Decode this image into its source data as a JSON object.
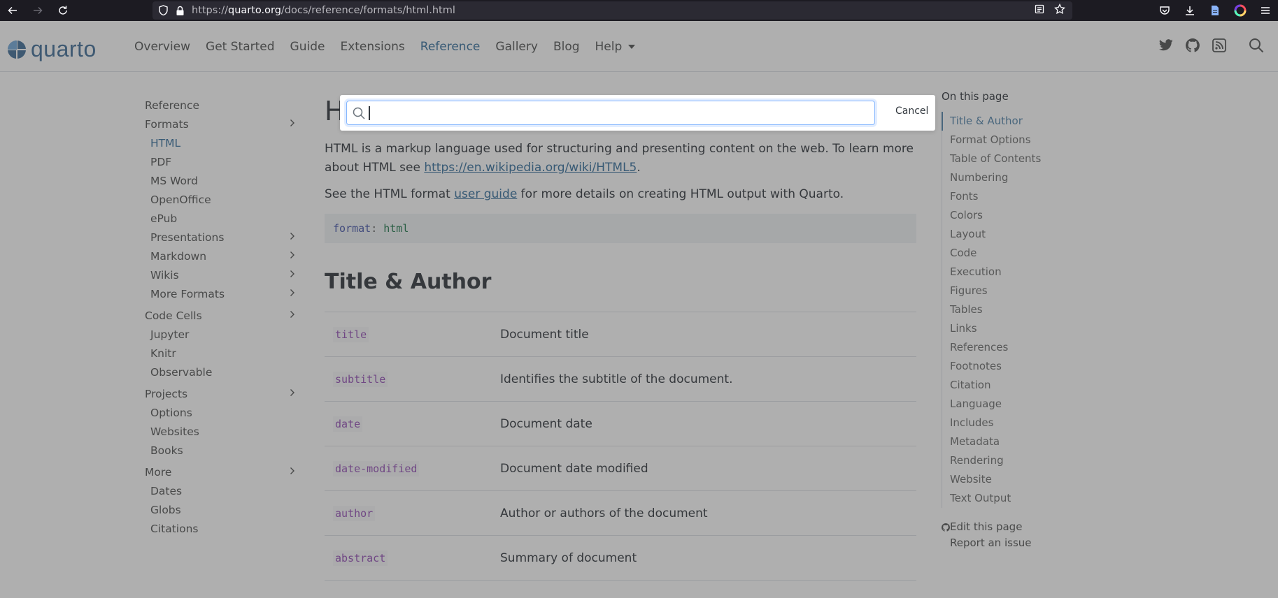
{
  "browser": {
    "url_scheme": "https://",
    "url_host": "quarto.org",
    "url_path": "/docs/reference/formats/html.html"
  },
  "header": {
    "logo_text": "quarto",
    "nav": [
      "Overview",
      "Get Started",
      "Guide",
      "Extensions",
      "Reference",
      "Gallery",
      "Blog",
      "Help"
    ],
    "active_nav": "Reference"
  },
  "sidebar": {
    "items": [
      {
        "label": "Reference",
        "level": 0,
        "chevron": false
      },
      {
        "label": "Formats",
        "level": 0,
        "chevron": true
      },
      {
        "label": "HTML",
        "level": 1,
        "chevron": false,
        "active": true
      },
      {
        "label": "PDF",
        "level": 1,
        "chevron": false
      },
      {
        "label": "MS Word",
        "level": 1,
        "chevron": false
      },
      {
        "label": "OpenOffice",
        "level": 1,
        "chevron": false
      },
      {
        "label": "ePub",
        "level": 1,
        "chevron": false
      },
      {
        "label": "Presentations",
        "level": 1,
        "chevron": true
      },
      {
        "label": "Markdown",
        "level": 1,
        "chevron": true
      },
      {
        "label": "Wikis",
        "level": 1,
        "chevron": true
      },
      {
        "label": "More Formats",
        "level": 1,
        "chevron": true
      },
      {
        "label": "Code Cells",
        "level": 0,
        "chevron": true,
        "section": true
      },
      {
        "label": "Jupyter",
        "level": 1,
        "chevron": false
      },
      {
        "label": "Knitr",
        "level": 1,
        "chevron": false
      },
      {
        "label": "Observable",
        "level": 1,
        "chevron": false
      },
      {
        "label": "Projects",
        "level": 0,
        "chevron": true,
        "section": true
      },
      {
        "label": "Options",
        "level": 1,
        "chevron": false
      },
      {
        "label": "Websites",
        "level": 1,
        "chevron": false
      },
      {
        "label": "Books",
        "level": 1,
        "chevron": false
      },
      {
        "label": "More",
        "level": 0,
        "chevron": true,
        "section": true
      },
      {
        "label": "Dates",
        "level": 1,
        "chevron": false
      },
      {
        "label": "Globs",
        "level": 1,
        "chevron": false
      },
      {
        "label": "Citations",
        "level": 1,
        "chevron": false
      }
    ]
  },
  "main": {
    "title_initial": "H",
    "intro_before": "HTML is a markup language used for structuring and presenting content on the web. To learn more about HTML see ",
    "intro_link": "https://en.wikipedia.org/wiki/HTML5",
    "intro_after": ".",
    "guide_before": "See the HTML format ",
    "guide_link": "user guide",
    "guide_after": " for more details on creating HTML output with Quarto.",
    "code_key": "format",
    "code_sep": ":",
    "code_value": "html",
    "section_title": "Title & Author",
    "options": [
      {
        "key": "title",
        "desc": "Document title"
      },
      {
        "key": "subtitle",
        "desc": "Identifies the subtitle of the document."
      },
      {
        "key": "date",
        "desc": "Document date"
      },
      {
        "key": "date-modified",
        "desc": "Document date modified"
      },
      {
        "key": "author",
        "desc": "Author or authors of the document"
      },
      {
        "key": "abstract",
        "desc": "Summary of document"
      }
    ]
  },
  "toc": {
    "title": "On this page",
    "items": [
      "Title & Author",
      "Format Options",
      "Table of Contents",
      "Numbering",
      "Fonts",
      "Colors",
      "Layout",
      "Code",
      "Execution",
      "Figures",
      "Tables",
      "Links",
      "References",
      "Footnotes",
      "Citation",
      "Language",
      "Includes",
      "Metadata",
      "Rendering",
      "Website",
      "Text Output"
    ],
    "active": "Title & Author",
    "edit_link": "Edit this page",
    "issue_link": "Report an issue"
  },
  "search": {
    "value": "",
    "cancel_label": "Cancel"
  },
  "colors": {
    "accent": "#39729e",
    "brand": "#447099",
    "option_key": "#9753b8",
    "focus_ring": "#86b7fe"
  }
}
